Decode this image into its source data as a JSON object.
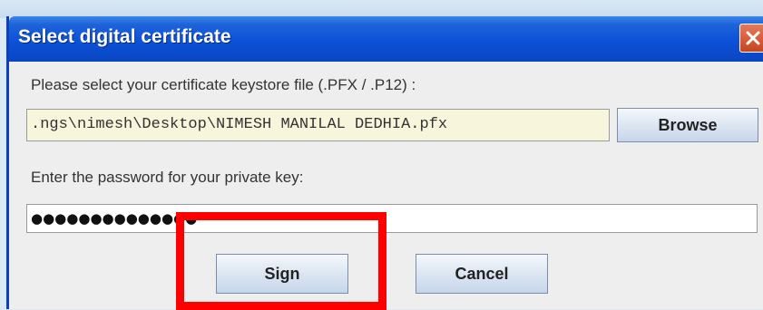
{
  "dialog": {
    "title": "Select digital certificate",
    "close_icon": "close-icon",
    "file_label": "Please select your certificate keystore file (.PFX / .P12) :",
    "file_path": ".ngs\\nimesh\\Desktop\\NIMESH MANILAL DEDHIA.pfx",
    "browse_label": "Browse",
    "password_label": "Enter the password for your private key:",
    "password_value": "●●●●●●●●●●●●●●",
    "sign_label": "Sign",
    "cancel_label": "Cancel"
  },
  "colors": {
    "titlebar": "#0c51d8",
    "highlight": "#ff0000",
    "close_button": "#d85a34"
  }
}
